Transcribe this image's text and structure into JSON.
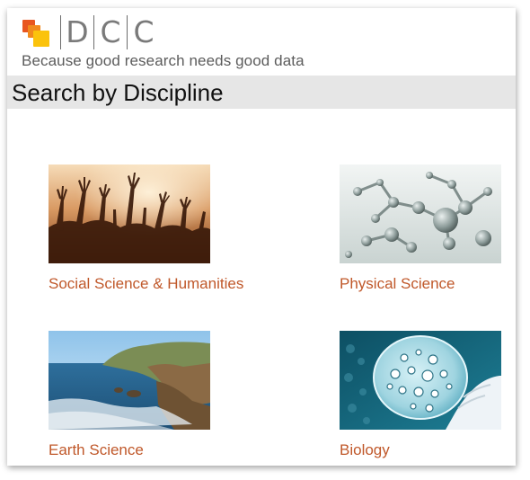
{
  "header": {
    "logo_letters": [
      "D",
      "C",
      "C"
    ],
    "tagline": "Because good research needs good data"
  },
  "page_title": "Search by Discipline",
  "disciplines": [
    {
      "label": "Social Science & Humanities",
      "image": "crowd-hands-image"
    },
    {
      "label": "Physical Science",
      "image": "molecules-image"
    },
    {
      "label": "Earth Science",
      "image": "coastline-image"
    },
    {
      "label": "Biology",
      "image": "petri-dish-image"
    }
  ],
  "colors": {
    "link": "#c0582a",
    "title_bar": "#e6e6e6",
    "logo_orange_dark": "#e8561f",
    "logo_orange": "#f18a1d",
    "logo_yellow": "#fbc30c"
  }
}
